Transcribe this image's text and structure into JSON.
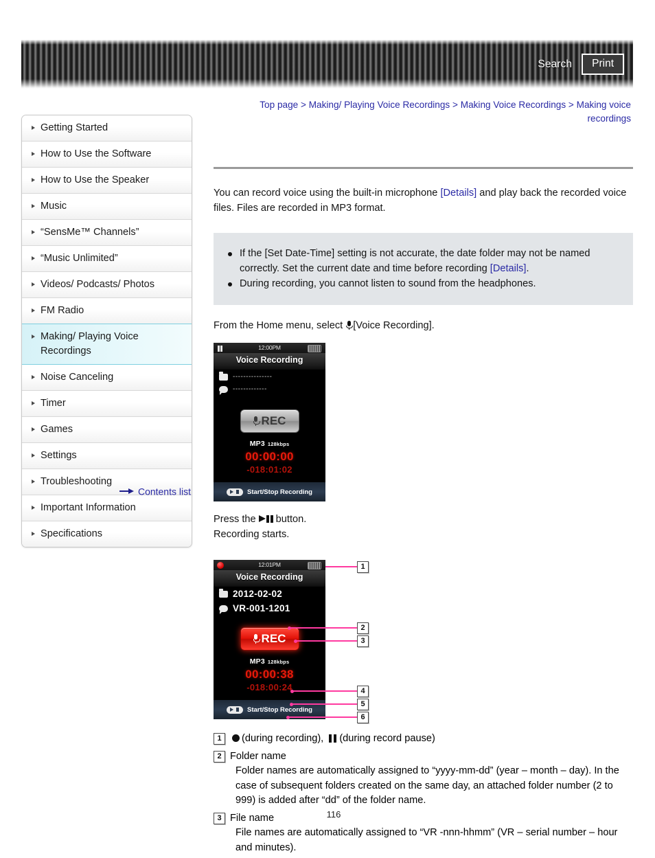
{
  "header": {
    "search_label": "Search",
    "print_label": "Print"
  },
  "breadcrumb": {
    "items": [
      "Top page",
      "Making/ Playing Voice Recordings",
      "Making Voice Recordings",
      "Making voice recordings"
    ],
    "separator": ">"
  },
  "sidebar": {
    "items": [
      {
        "label": "Getting Started",
        "selected": false
      },
      {
        "label": "How to Use the Software",
        "selected": false
      },
      {
        "label": "How to Use the Speaker",
        "selected": false
      },
      {
        "label": "Music",
        "selected": false
      },
      {
        "label": "“SensMe™ Channels”",
        "selected": false
      },
      {
        "label": "“Music Unlimited”",
        "selected": false
      },
      {
        "label": "Videos/ Podcasts/ Photos",
        "selected": false
      },
      {
        "label": "FM Radio",
        "selected": false
      },
      {
        "label": "Making/ Playing Voice Recordings",
        "selected": true
      },
      {
        "label": "Noise Canceling",
        "selected": false
      },
      {
        "label": "Timer",
        "selected": false
      },
      {
        "label": "Games",
        "selected": false
      },
      {
        "label": "Settings",
        "selected": false
      },
      {
        "label": "Troubleshooting",
        "selected": false
      },
      {
        "label": "Important Information",
        "selected": false
      },
      {
        "label": "Specifications",
        "selected": false
      }
    ],
    "contents_list_label": "Contents list"
  },
  "main": {
    "intro_part1": "You can record voice using the built-in microphone ",
    "intro_link": "[Details]",
    "intro_part2": " and play back the recorded voice files. Files are recorded in MP3 format.",
    "notes": [
      {
        "text_before": "If the [Set Date-Time] setting is not accurate, the date folder may not be named correctly. Set the current date and time before recording ",
        "link": "[Details]",
        "text_after": "."
      },
      {
        "text_before": "During recording, you cannot listen to sound from the headphones.",
        "link": "",
        "text_after": ""
      }
    ],
    "step1_before": "From the Home menu, select",
    "step1_after": "[Voice Recording].",
    "step2_before": "Press the",
    "step2_after": "button.",
    "step2_line2": "Recording starts."
  },
  "device_idle": {
    "time": "12:00PM",
    "title": "Voice Recording",
    "folder_value": "---------------",
    "file_value": "-------------",
    "rec_label": "REC",
    "format": "MP3",
    "bitrate": "128kbps",
    "elapsed": "00:00:00",
    "remaining": "-018:01:02",
    "footer_label": "Start/Stop Recording"
  },
  "device_recording": {
    "time": "12:01PM",
    "title": "Voice Recording",
    "folder_value": "2012-02-02",
    "file_value": "VR-001-1201",
    "rec_label": "REC",
    "format": "MP3",
    "bitrate": "128kbps",
    "elapsed": "00:00:38",
    "remaining": "-018:00:24",
    "footer_label": "Start/Stop Recording"
  },
  "callouts": [
    "1",
    "2",
    "3",
    "4",
    "5",
    "6"
  ],
  "legend": [
    {
      "num": "1",
      "title_a": "(during recording),",
      "title_b": "(during record pause)",
      "desc": ""
    },
    {
      "num": "2",
      "title": "Folder name",
      "desc": "Folder names are automatically assigned to “yyyy-mm-dd” (year – month – day). In the case of subsequent folders created on the same day, an attached folder number (2 to 999) is added after “dd” of the folder name."
    },
    {
      "num": "3",
      "title": "File name",
      "desc": "File names are automatically assigned to “VR -nnn-hhmm” (VR – serial number – hour and minutes)."
    }
  ],
  "page_number": "116",
  "colors": {
    "link": "#2a2aa5",
    "callout_line": "#ff3aa0",
    "note_bg": "#e2e5e8",
    "selected_sidebar": "#d6f2f7",
    "rec_red": "#e8190a"
  }
}
